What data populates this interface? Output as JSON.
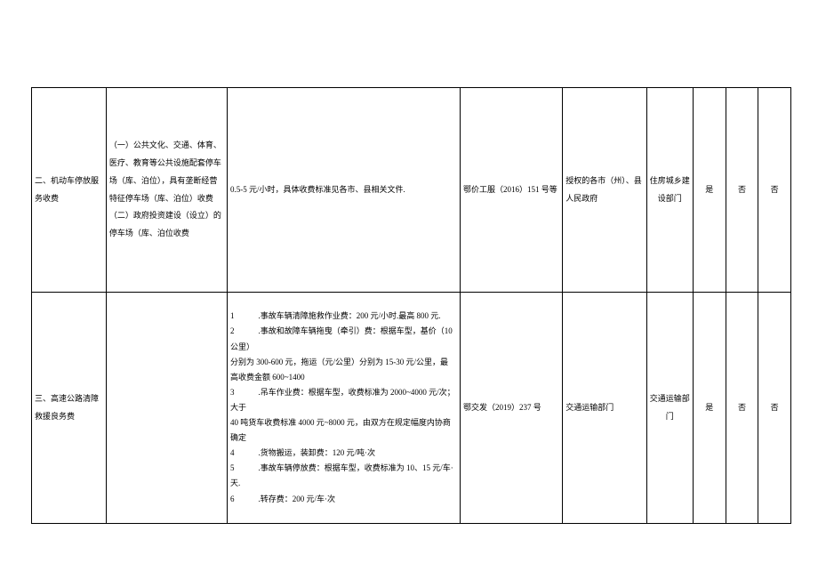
{
  "rows": [
    {
      "col1": "二、机动车停放服务收费",
      "col2": "（一）公共文化、交通、体育、医疗、教育等公共设施配套停车场（库、泊位），具有垄断经营特征停车场（库、泊位）收费\n（二）政府投资建设（设立）的停车场（库、泊位收费",
      "col3": "0.5-5 元/小时，具体收费标准见各市、县相关文件.",
      "col4": "鄂价工服（2016）151 号等",
      "col5": "授权的各市（州）、县人民政府",
      "col6": "住房城乡建设部门",
      "col7": "是",
      "col8": "否",
      "col9": "否"
    },
    {
      "col1": "三、高速公路清障救援良务费",
      "col2": "",
      "col3": "1　　　.事故车辆清障施救作业费：200 元/小时.最高 800 元.\n2　　　.事故和故障车辆拖曳（牵引）费：根据车型，基价（10 公里）\n分别为 300-600 元，拖运（元/公里）分别为 15-30 元/公里，最\n高收费金额 600~1400\n3　　　.吊车作业费：根据车型，收费标准为 2000~4000 元/次；大于\n40 吨货车收费标准 4000 元~8000 元，由双方在规定幅度内协商\n确定\n4　　　.货物搬运，装卸费：120 元/吨·次\n5　　　.事故车辆停放费：根据车型，收费标准为 10、15 元/车·天.\n6　　　.转存费：200 元/车·次",
      "col4": "鄂交发（2019）237 号",
      "col5": "交通运输部门",
      "col6": "交通运输部门",
      "col7": "是",
      "col8": "否",
      "col9": "否"
    }
  ]
}
